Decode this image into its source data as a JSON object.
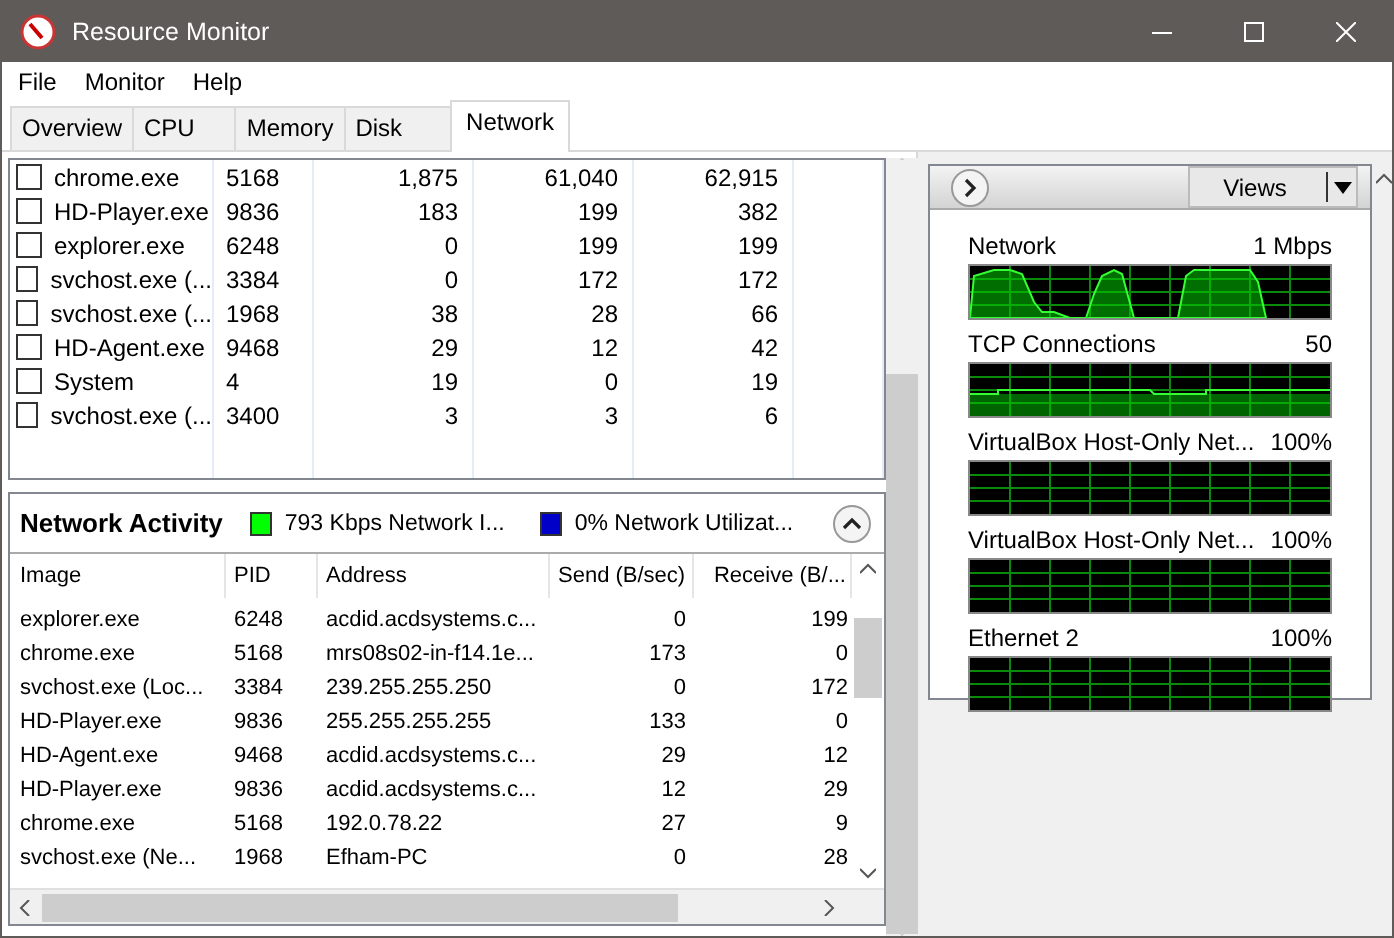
{
  "window": {
    "title": "Resource Monitor"
  },
  "menu": [
    "File",
    "Monitor",
    "Help"
  ],
  "tabs": [
    {
      "label": "Overview",
      "selected": false
    },
    {
      "label": "CPU",
      "selected": false
    },
    {
      "label": "Memory",
      "selected": false
    },
    {
      "label": "Disk",
      "selected": false
    },
    {
      "label": "Network",
      "selected": true
    }
  ],
  "processes": {
    "rows": [
      {
        "checked": false,
        "column_1": "chrome.exe",
        "column_2": "5168",
        "column_3": "1,875",
        "column_4": "61,040",
        "column_5": "62,915"
      },
      {
        "checked": false,
        "column_1": "HD-Player.exe",
        "column_2": "9836",
        "column_3": "183",
        "column_4": "199",
        "column_5": "382"
      },
      {
        "checked": false,
        "column_1": "explorer.exe",
        "column_2": "6248",
        "column_3": "0",
        "column_4": "199",
        "column_5": "199"
      },
      {
        "checked": false,
        "column_1": "svchost.exe (...",
        "column_2": "3384",
        "column_3": "0",
        "column_4": "172",
        "column_5": "172"
      },
      {
        "checked": false,
        "column_1": "svchost.exe (...",
        "column_2": "1968",
        "column_3": "38",
        "column_4": "28",
        "column_5": "66"
      },
      {
        "checked": false,
        "column_1": "HD-Agent.exe",
        "column_2": "9468",
        "column_3": "29",
        "column_4": "12",
        "column_5": "42"
      },
      {
        "checked": false,
        "column_1": "System",
        "column_2": "4",
        "column_3": "19",
        "column_4": "0",
        "column_5": "19"
      },
      {
        "checked": false,
        "column_1": "svchost.exe (...",
        "column_2": "3400",
        "column_3": "3",
        "column_4": "3",
        "column_5": "6"
      }
    ]
  },
  "network_activity": {
    "title": "Network Activity",
    "legend": [
      {
        "label": "793 Kbps Network I...",
        "color": "#00ff00"
      },
      {
        "label": "0% Network Utilizat...",
        "color": "#0000c8"
      }
    ],
    "columns": [
      "Image",
      "PID",
      "Address",
      "Send (B/sec)",
      "Receive (B/..."
    ],
    "rows": [
      [
        "explorer.exe",
        "6248",
        "acdid.acdsystems.c...",
        "0",
        "199"
      ],
      [
        "chrome.exe",
        "5168",
        "mrs08s02-in-f14.1e...",
        "173",
        "0"
      ],
      [
        "svchost.exe (Loc...",
        "3384",
        "239.255.255.250",
        "0",
        "172"
      ],
      [
        "HD-Player.exe",
        "9836",
        "255.255.255.255",
        "133",
        "0"
      ],
      [
        "HD-Agent.exe",
        "9468",
        "acdid.acdsystems.c...",
        "29",
        "12"
      ],
      [
        "HD-Player.exe",
        "9836",
        "acdid.acdsystems.c...",
        "12",
        "29"
      ],
      [
        "chrome.exe",
        "5168",
        "192.0.78.22",
        "27",
        "9"
      ],
      [
        "svchost.exe (Ne...",
        "1968",
        "Efham-PC",
        "0",
        "28"
      ]
    ]
  },
  "graphs_panel": {
    "views_button": "Views",
    "graphs": [
      {
        "kind": "area",
        "label": "Network",
        "value": "1 Mbps"
      },
      {
        "kind": "line",
        "label": "TCP Connections",
        "value": "50"
      },
      {
        "kind": "empty",
        "label": "VirtualBox Host-Only Net...",
        "value": "100%"
      },
      {
        "kind": "empty",
        "label": "VirtualBox Host-Only Net...",
        "value": "100%"
      },
      {
        "kind": "empty",
        "label": "Ethernet 2",
        "value": "100%"
      }
    ]
  }
}
